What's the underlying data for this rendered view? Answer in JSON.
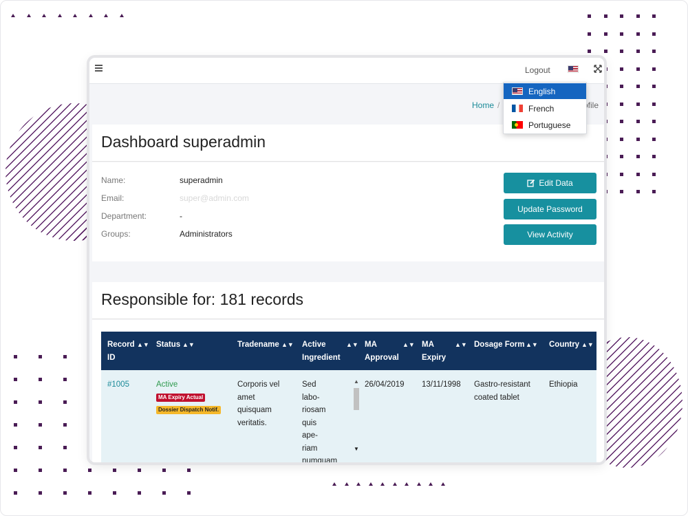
{
  "topbar": {
    "menu_icon": "hamburger-icon",
    "logout_label": "Logout",
    "flag_icon": "us-flag-icon",
    "expand_icon": "fullscreen-icon"
  },
  "language_menu": {
    "items": [
      {
        "label": "English",
        "flag": "us-flag-icon",
        "selected": true
      },
      {
        "label": "French",
        "flag": "fr-flag-icon",
        "selected": false
      },
      {
        "label": "Portuguese",
        "flag": "pt-flag-icon",
        "selected": false
      }
    ]
  },
  "breadcrumb": {
    "home": "Home",
    "separator": "/",
    "current": "ofile"
  },
  "dashboard": {
    "title": "Dashboard superadmin",
    "fields": [
      {
        "label": "Name:",
        "value": "superadmin"
      },
      {
        "label": "Email:",
        "value": "super@admin.com"
      },
      {
        "label": "Department:",
        "value": "-"
      },
      {
        "label": "Groups:",
        "value": "Administrators"
      }
    ],
    "buttons": {
      "edit": "Edit Data",
      "password": "Update Password",
      "activity": "View Activity"
    }
  },
  "records": {
    "title": "Responsible for: 181 records",
    "columns": [
      "Record ID",
      "Status",
      "Tradename",
      "Active Ingredient",
      "MA Approval",
      "MA Expiry",
      "Dosage Form",
      "Country"
    ],
    "rows": [
      {
        "id": "#1005",
        "status": "Active",
        "badges": [
          "MA Expiry Actual",
          "Dossier Dispatch Notif."
        ],
        "tradename": "Corporis vel amet quisquam veritatis.",
        "active_ingredient": "Sed labo- riosam quis ape- riam numquam rem rerum",
        "ma_approval": "26/04/2019",
        "ma_expiry": "13/11/1998",
        "dosage_form": "Gastro-resistant coated tablet",
        "country": "Ethiopia"
      }
    ]
  },
  "colors": {
    "accent": "#17909f",
    "table_header": "#12335e",
    "row_bg": "#e6f2f6",
    "dropdown_selected": "#1565c0",
    "decoration": "#4a1c55"
  }
}
